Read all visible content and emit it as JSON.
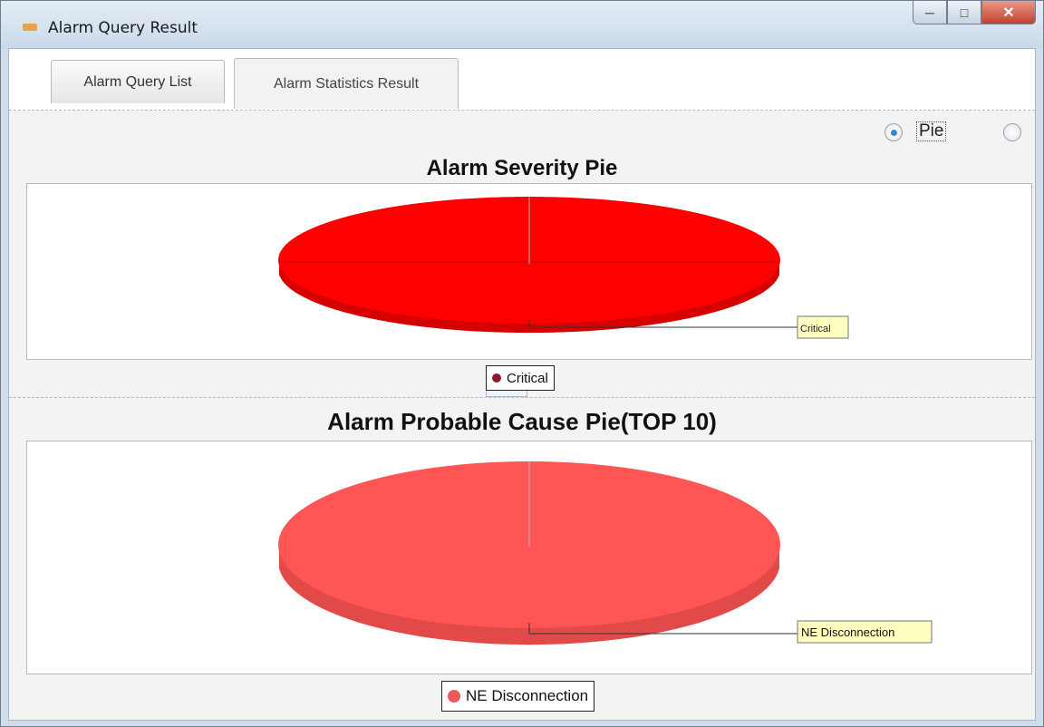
{
  "window": {
    "title": "Alarm Query Result",
    "controls": [
      "minimize",
      "maximize",
      "close"
    ]
  },
  "tabs": [
    {
      "label": "Alarm Query List",
      "selected": false
    },
    {
      "label": "Alarm Statistics Result",
      "selected": true
    }
  ],
  "chart_type_options": [
    {
      "label": "Pie",
      "selected": true
    },
    {
      "label": "",
      "selected": false
    }
  ],
  "chart_data": [
    {
      "type": "pie",
      "title": "Alarm Severity Pie",
      "categories": [
        "Critical"
      ],
      "values": [
        100
      ],
      "colors": [
        "#ff0000"
      ],
      "legend": [
        "Critical"
      ],
      "legend_placement": "bottom"
    },
    {
      "type": "pie",
      "title": "Alarm Probable Cause Pie(TOP 10)",
      "categories": [
        "NE Disconnection"
      ],
      "values": [
        100
      ],
      "colors": [
        "#ff5555"
      ],
      "legend": [
        "NE Disconnection"
      ],
      "legend_placement": "bottom"
    }
  ],
  "colors": {
    "critical_red": "#ff0000",
    "critical_side": "#d60000",
    "cause_red": "#ff5555",
    "cause_side": "#e24a4a",
    "legend_critical_dot": "#8b1a2b",
    "legend_cause_dot": "#e85a5a",
    "tooltip_bg": "#ffffc0"
  }
}
